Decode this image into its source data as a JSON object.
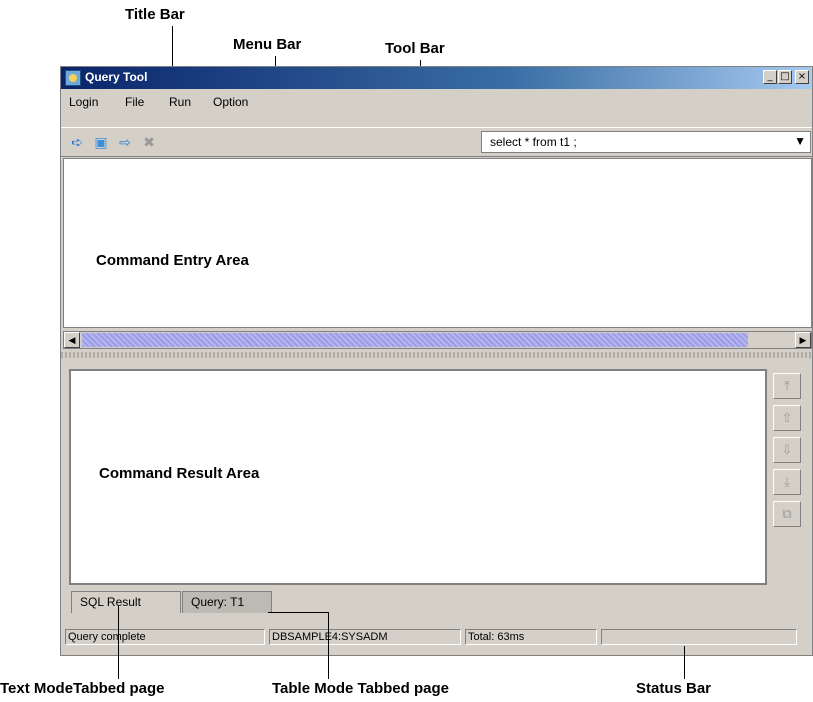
{
  "callouts": {
    "title_bar": "Title Bar",
    "menu_bar": "Menu Bar",
    "tool_bar": "Tool Bar",
    "text_mode_tab": "Text ModeTabbed page",
    "table_mode_tab": "Table Mode Tabbed page",
    "status_bar": "Status Bar"
  },
  "window": {
    "title": "Query Tool",
    "controls": [
      "_",
      "□",
      "×"
    ]
  },
  "menu": {
    "items": [
      "Login",
      "File",
      "Run",
      "Option"
    ]
  },
  "toolbar": {
    "icons": [
      "execute-icon",
      "open-icon",
      "run-file-icon",
      "cancel-icon"
    ],
    "query_value": "select * from t1 ;"
  },
  "areas": {
    "entry_label": "Command Entry Area",
    "result_label": "Command Result Area"
  },
  "tabs": [
    {
      "label": "SQL Result",
      "active": true
    },
    {
      "label": "Query: T1",
      "active": false
    }
  ],
  "side_buttons": [
    "first-icon",
    "up-icon",
    "down-icon",
    "last-icon",
    "copy-icon"
  ],
  "status": {
    "message": "Query complete",
    "connection": "DBSAMPLE4:SYSADM",
    "total": "Total: 63ms",
    "extra": ""
  }
}
